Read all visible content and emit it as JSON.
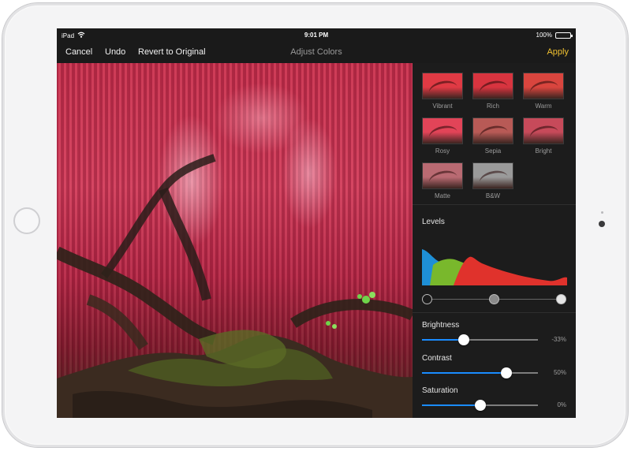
{
  "status_bar": {
    "device": "iPad",
    "time": "9:01 PM",
    "battery": "100%",
    "battery_level": 1.0
  },
  "nav": {
    "cancel": "Cancel",
    "undo": "Undo",
    "revert": "Revert to Original",
    "title": "Adjust Colors",
    "apply": "Apply"
  },
  "filters": [
    {
      "label": "Vibrant",
      "color": "#e03a44"
    },
    {
      "label": "Rich",
      "color": "#d8343f"
    },
    {
      "label": "Warm",
      "color": "#d9453e"
    },
    {
      "label": "Rosy",
      "color": "#e24458"
    },
    {
      "label": "Sepia",
      "color": "#b85a56"
    },
    {
      "label": "Bright",
      "color": "#c74a5a"
    },
    {
      "label": "Matte",
      "color": "#b96a72"
    },
    {
      "label": "B&W",
      "color": "#9a9a9a"
    }
  ],
  "levels": {
    "title": "Levels",
    "knob_positions": [
      0.0,
      0.5,
      1.0
    ]
  },
  "adjustments": [
    {
      "label": "Brightness",
      "value": "-33%",
      "position": 0.36
    },
    {
      "label": "Contrast",
      "value": "50%",
      "position": 0.73
    },
    {
      "label": "Saturation",
      "value": "0%",
      "position": 0.5
    }
  ],
  "colors": {
    "accent": "#f2c230",
    "slider_fill": "#1a8cff",
    "histogram_blue": "#1e8fd6",
    "histogram_green": "#79b82c",
    "histogram_red": "#e0322c"
  }
}
